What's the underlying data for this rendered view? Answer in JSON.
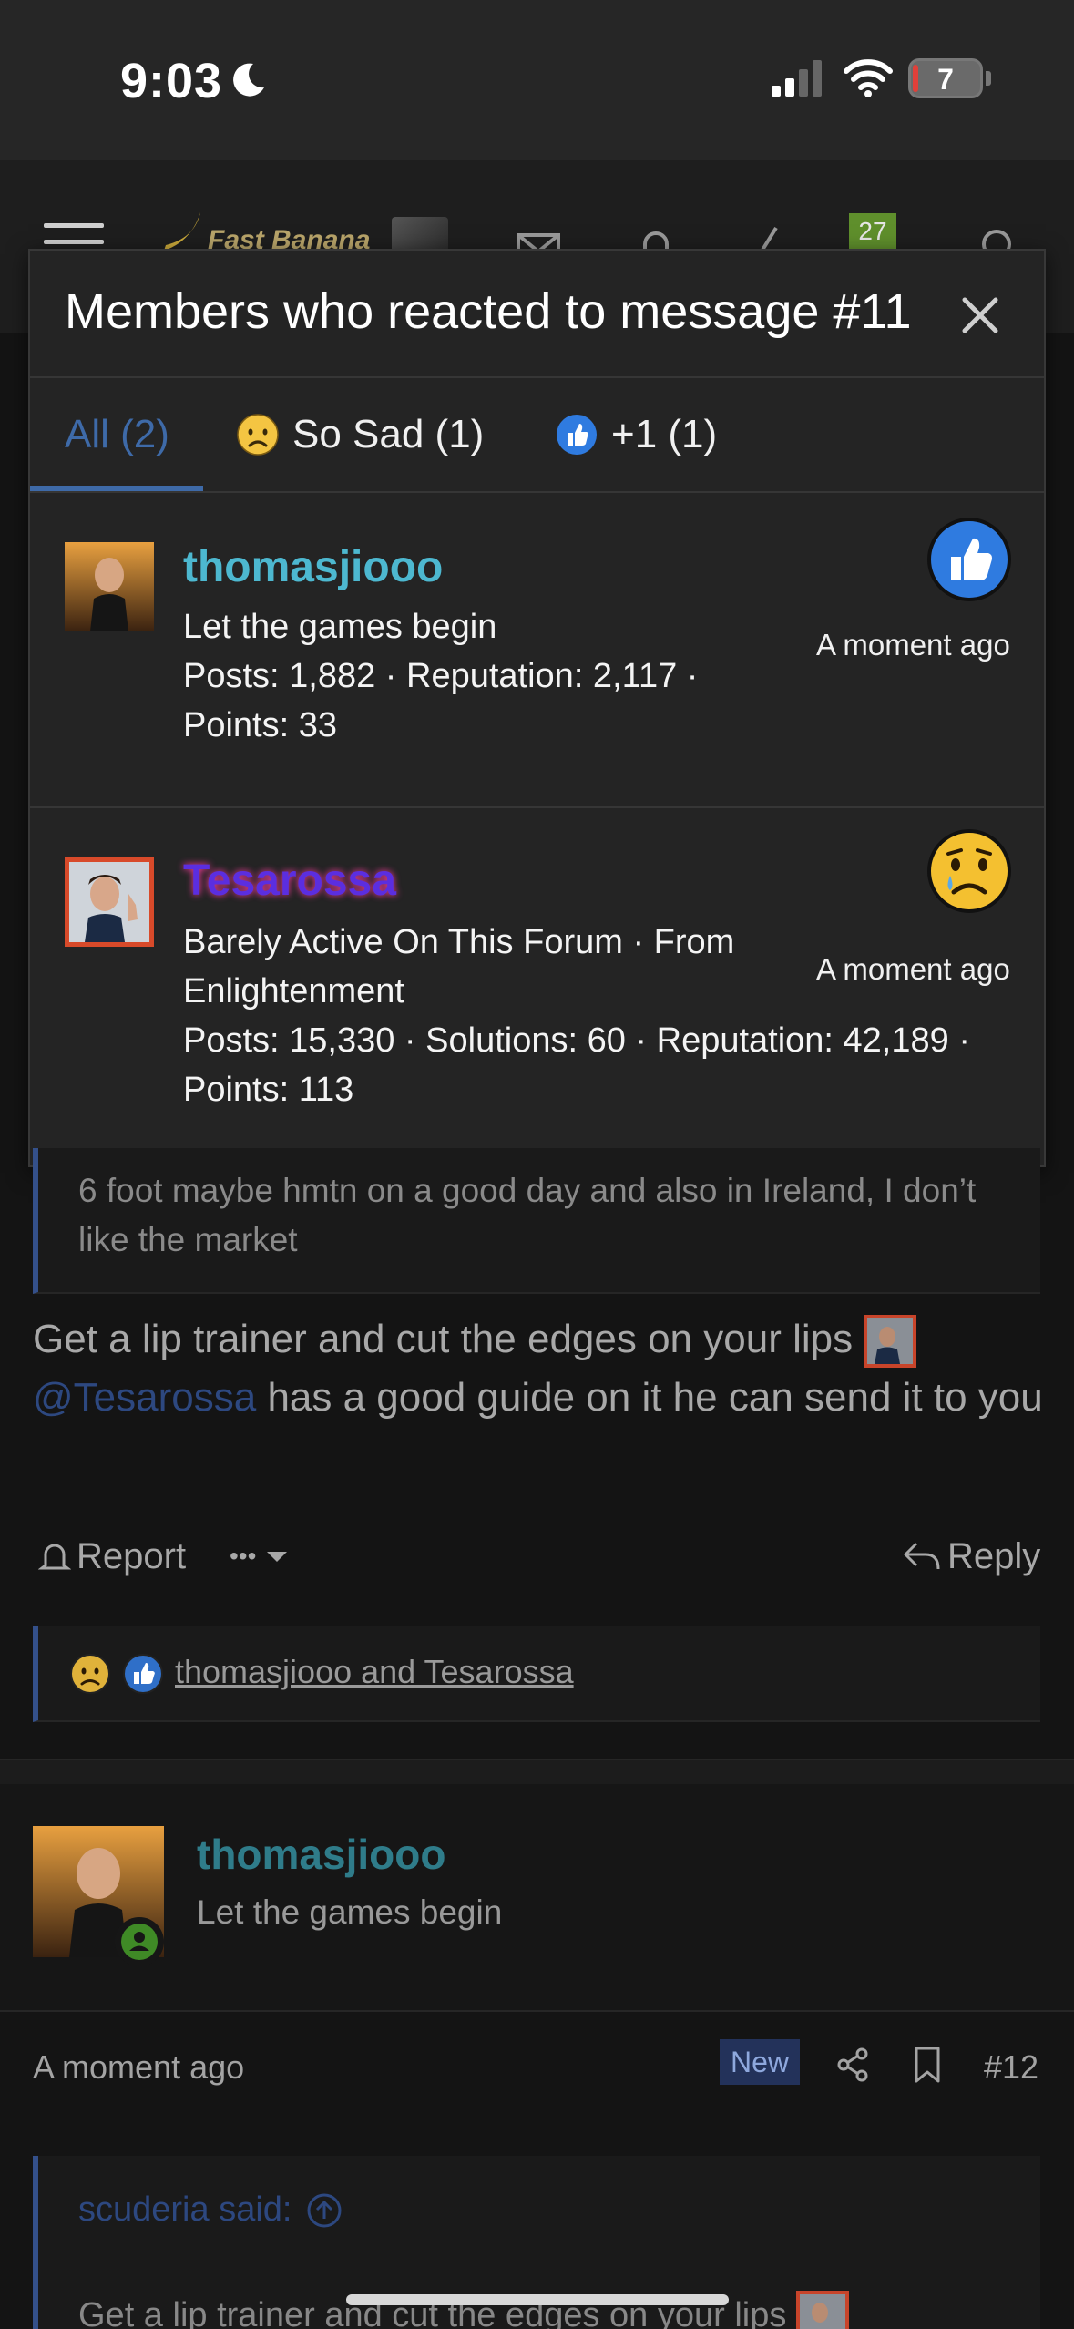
{
  "status_bar": {
    "time": "9:03",
    "battery": "7"
  },
  "header": {
    "logo_text": "Fast Banana",
    "alerts_badge": "27"
  },
  "modal": {
    "title": "Members who reacted to message #11",
    "tabs": [
      {
        "label": "All (2)"
      },
      {
        "label": "So Sad (1)"
      },
      {
        "label": "+1 (1)"
      }
    ],
    "reactions": [
      {
        "username": "thomasjiooo",
        "user_title": "Let the games begin",
        "stats_line1": "Posts: 1,882 · Reputation: 2,117 ·",
        "stats_line2": "Points: 33",
        "time": "A moment ago",
        "reaction": "thumbs-up"
      },
      {
        "username": "Tesarossa",
        "user_title": "Barely Active On This Forum · From",
        "user_title2": "Enlightenment",
        "stats_line1": "Posts: 15,330 · Solutions: 60 · Reputation: 42,189 ·",
        "stats_line2": "Points: 113",
        "time": "A moment ago",
        "reaction": "sad-face"
      }
    ]
  },
  "post11": {
    "quote_text": "6 foot maybe hmtn on a good day and also in Ireland, I don’t like the market",
    "body_part1": "Get a lip trainer and cut the edges on your lips",
    "mention": "@Tesarossa",
    "body_part2": "has a good guide on it he can send it to you",
    "report_label": "Report",
    "more_label": "•••",
    "reply_label": "Reply",
    "reactions_summary": "thomasjiooo and Tesarossa"
  },
  "post12": {
    "username": "thomasjiooo",
    "user_title": "Let the games begin",
    "time": "A moment ago",
    "new_badge": "New",
    "post_number": "#12",
    "quote_author": "scuderia said:",
    "quote_text": "Get a lip trainer and cut the edges on your lips"
  },
  "colors": {
    "accent_blue": "#3e6aa8",
    "username_teal": "#4db8d0",
    "username_purple": "#5b2ee0",
    "background": "#141414",
    "modal_bg": "#242424"
  }
}
